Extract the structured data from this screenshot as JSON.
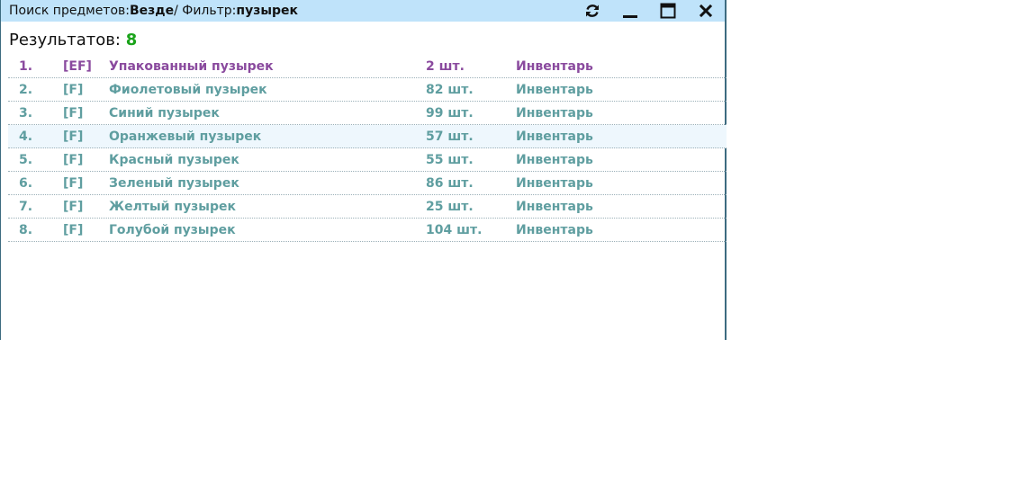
{
  "titlebar": {
    "search_prefix": "Поиск предметов: ",
    "scope": "Везде",
    "separator": " / Фильтр: ",
    "filter": "пузырек",
    "controls": [
      "refresh-icon",
      "minimize-icon",
      "maximize-icon",
      "close-icon"
    ]
  },
  "results": {
    "label": "Результатов: ",
    "count": "8"
  },
  "colors": {
    "titlebar_bg": "#bfe3fa",
    "row_text": "#5f9ea0",
    "row_text_special": "#8a4a9e",
    "count": "#1aa31a"
  },
  "items": [
    {
      "num": "1.",
      "tag": "[EF]",
      "name": "Упакованный пузырек",
      "qty": "2 шт.",
      "location": "Инвентарь"
    },
    {
      "num": "2.",
      "tag": "[F]",
      "name": "Фиолетовый пузырек",
      "qty": "82 шт.",
      "location": "Инвентарь"
    },
    {
      "num": "3.",
      "tag": "[F]",
      "name": "Синий пузырек",
      "qty": "99 шт.",
      "location": "Инвентарь"
    },
    {
      "num": "4.",
      "tag": "[F]",
      "name": "Оранжевый пузырек",
      "qty": "57 шт.",
      "location": "Инвентарь"
    },
    {
      "num": "5.",
      "tag": "[F]",
      "name": "Красный пузырек",
      "qty": "55 шт.",
      "location": "Инвентарь"
    },
    {
      "num": "6.",
      "tag": "[F]",
      "name": "Зеленый пузырек",
      "qty": "86 шт.",
      "location": "Инвентарь"
    },
    {
      "num": "7.",
      "tag": "[F]",
      "name": "Желтый пузырек",
      "qty": "25 шт.",
      "location": "Инвентарь"
    },
    {
      "num": "8.",
      "tag": "[F]",
      "name": "Голубой пузырек",
      "qty": "104 шт.",
      "location": "Инвентарь"
    }
  ]
}
